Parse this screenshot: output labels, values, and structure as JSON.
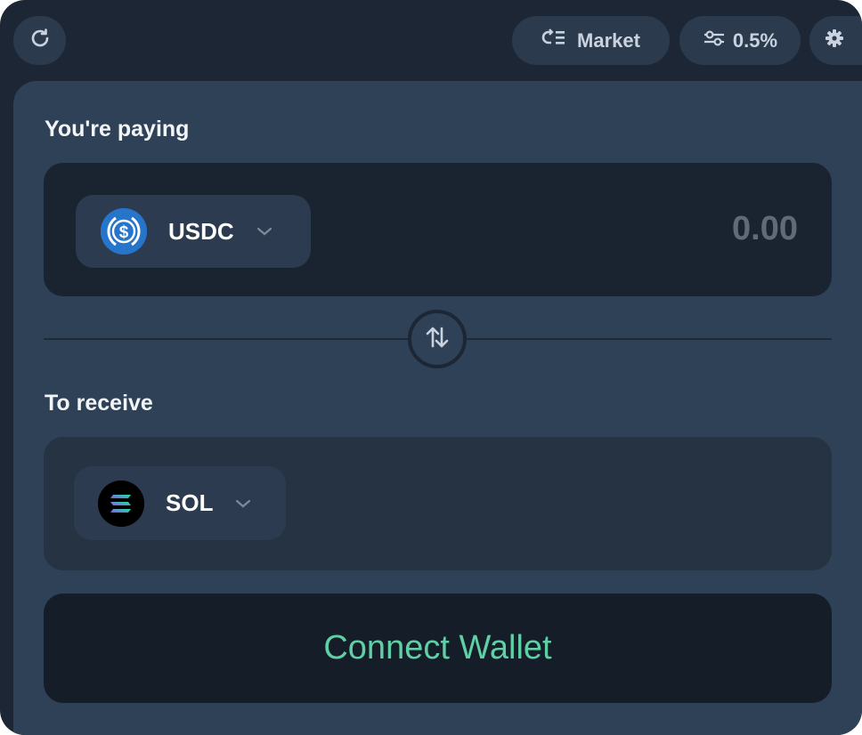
{
  "toolbar": {
    "refresh_icon": "refresh-icon",
    "mode_label": "Market",
    "mode_icon": "market-routing-icon",
    "slippage_label": "0.5%",
    "slippage_icon": "sliders-icon",
    "settings_icon": "gear-icon"
  },
  "pay": {
    "label": "You're paying",
    "token": "USDC",
    "token_icon": "usdc-icon",
    "amount": "0.00"
  },
  "switch": {
    "icon": "swap-arrows-icon"
  },
  "receive": {
    "label": "To receive",
    "token": "SOL",
    "token_icon": "sol-icon"
  },
  "action": {
    "label": "Connect Wallet"
  },
  "colors": {
    "background": "#1d2634",
    "panel": "#2f4156",
    "input_dark": "#1a2330",
    "accent_green": "#5fd0a6",
    "usdc_blue": "#2775ca"
  }
}
